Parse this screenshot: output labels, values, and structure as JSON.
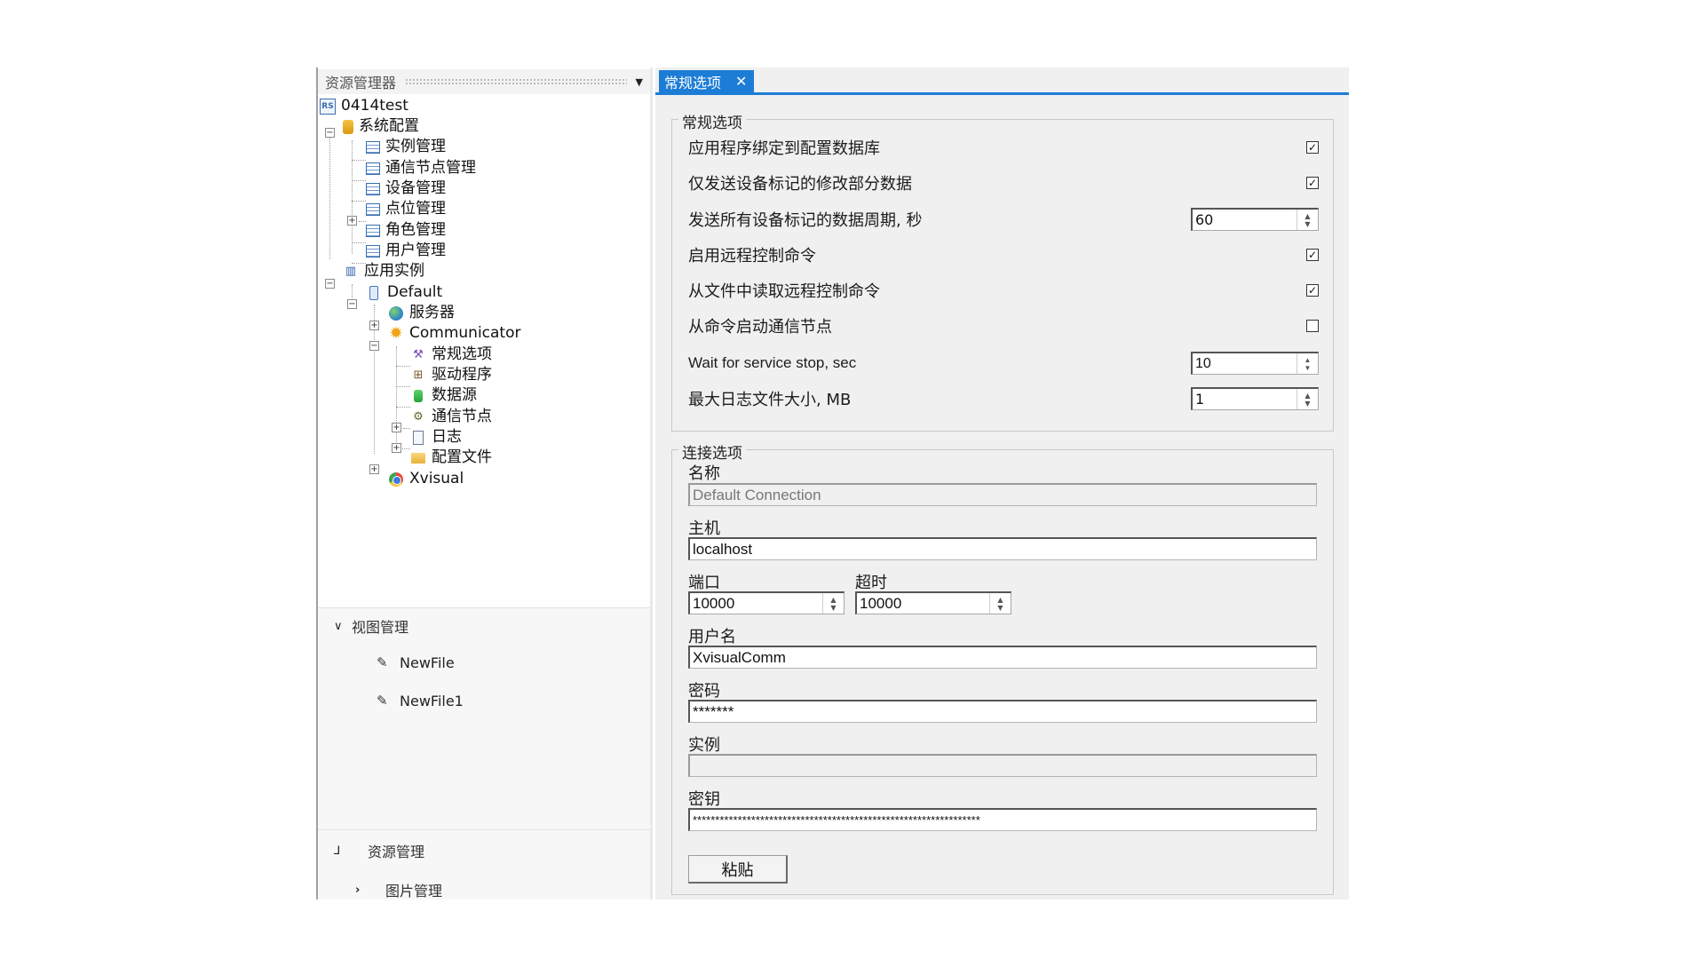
{
  "explorer": {
    "title": "资源管理器",
    "tree": {
      "root": "0414test",
      "system_config": "系统配置",
      "instance_mgmt": "实例管理",
      "comm_node_mgmt": "通信节点管理",
      "device_mgmt": "设备管理",
      "point_mgmt": "点位管理",
      "role_mgmt": "角色管理",
      "user_mgmt": "用户管理",
      "app_instances": "应用实例",
      "default": "Default",
      "server": "服务器",
      "communicator": "Communicator",
      "general_options": "常规选项",
      "driver": "驱动程序",
      "datasource": "数据源",
      "comm_nodes": "通信节点",
      "log": "日志",
      "config_files": "配置文件",
      "xvisual": "Xvisual"
    }
  },
  "view_mgmt": {
    "title": "视图管理",
    "files": [
      "NewFile",
      "NewFile1"
    ]
  },
  "resource_mgmt": {
    "title": "资源管理",
    "image_mgmt": "图片管理"
  },
  "tab": {
    "label": "常规选项",
    "close_icon": "close-icon"
  },
  "general": {
    "title": "常规选项",
    "options": [
      {
        "label": "应用程序绑定到配置数据库",
        "type": "checkbox",
        "checked": true,
        "mark": "✓"
      },
      {
        "label": "仅发送设备标记的修改部分数据",
        "type": "checkbox",
        "checked": true,
        "mark": "✓"
      },
      {
        "label": "发送所有设备标记的数据周期, 秒",
        "type": "spin",
        "value": "60"
      },
      {
        "label": "启用远程控制命令",
        "type": "checkbox",
        "checked": true,
        "mark": "✓"
      },
      {
        "label": "从文件中读取远程控制命令",
        "type": "checkbox",
        "checked": true,
        "mark": "✓"
      },
      {
        "label": "从命令启动通信节点",
        "type": "checkbox",
        "checked": false,
        "mark": ""
      },
      {
        "label": "Wait for service stop, sec",
        "type": "spin",
        "value": "10"
      },
      {
        "label": "最大日志文件大小, MB",
        "type": "spin",
        "value": "1"
      }
    ]
  },
  "connection": {
    "title": "连接选项",
    "name_label": "名称",
    "name_value": "Default Connection",
    "host_label": "主机",
    "host_value": "localhost",
    "port_label": "端口",
    "port_value": "10000",
    "timeout_label": "超时",
    "timeout_value": "10000",
    "username_label": "用户名",
    "username_value": "XvisualComm",
    "password_label": "密码",
    "password_value": "*******",
    "instance_label": "实例",
    "instance_value": "",
    "key_label": "密钥",
    "key_value": "****************************************************************",
    "paste_label": "粘贴"
  },
  "colors": {
    "accent": "#1c7dd6",
    "panel_bg": "#f0f0f0"
  }
}
